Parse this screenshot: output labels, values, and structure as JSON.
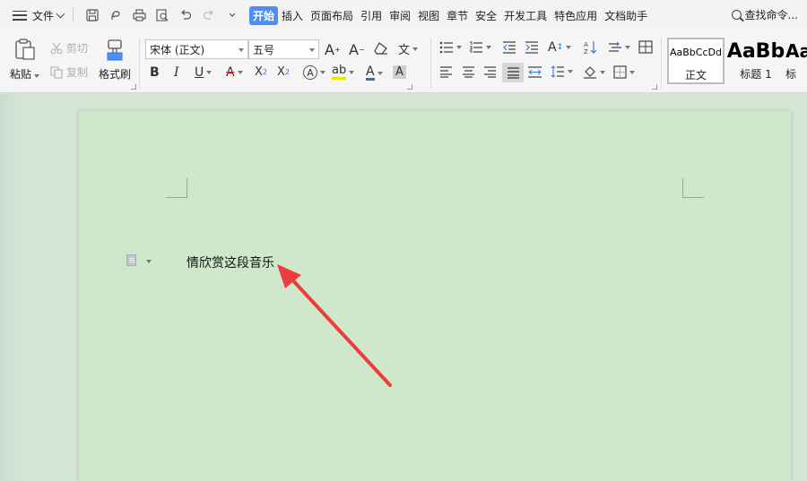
{
  "menubar": {
    "file_label": "文件",
    "tabs": [
      "开始",
      "插入",
      "页面布局",
      "引用",
      "审阅",
      "视图",
      "章节",
      "安全",
      "开发工具",
      "特色应用",
      "文档助手"
    ],
    "active_tab": "开始",
    "search_label": "查找命令..."
  },
  "ribbon": {
    "paste_label": "粘贴",
    "cut_label": "剪切",
    "copy_label": "复制",
    "format_painter_label": "格式刷",
    "font_name": "宋体 (正文)",
    "font_size": "五号",
    "bold": "B",
    "italic": "I",
    "underline": "U",
    "styles": [
      {
        "sample": "AaBbCcDd",
        "name": "正文"
      },
      {
        "sample": "AaBb",
        "name": "标题 1"
      },
      {
        "sample": "Aa",
        "name": "标"
      }
    ]
  },
  "document": {
    "text": "情欣赏这段音乐"
  },
  "colors": {
    "accent": "#4c8ef5",
    "page_bg": "#cfe8cc",
    "arrow": "#ee3b3b"
  }
}
